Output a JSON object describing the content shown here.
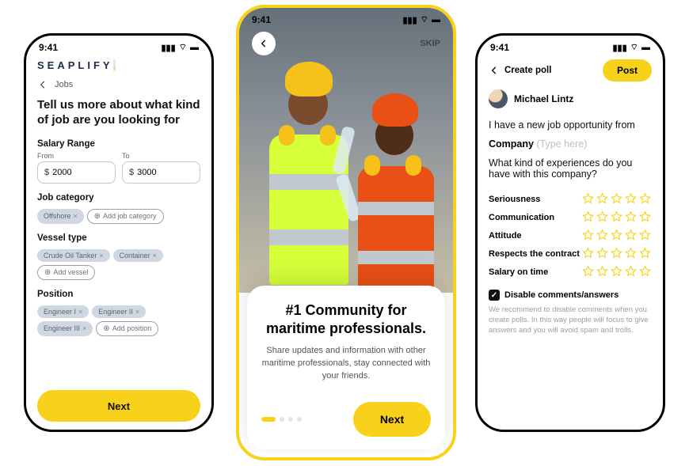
{
  "status": {
    "time": "9:41"
  },
  "left": {
    "brand": "SEAPLIFY",
    "back_label": "Jobs",
    "heading": "Tell us more about what kind of job are you looking for",
    "salary": {
      "section": "Salary Range",
      "from_label": "From",
      "to_label": "To",
      "from_value": "2000",
      "to_value": "3000",
      "currency": "$"
    },
    "category": {
      "section": "Job category",
      "chips": [
        "Offshore"
      ],
      "add": "Add job category"
    },
    "vessel": {
      "section": "Vessel type",
      "chips": [
        "Crude Oil Tanker",
        "Container"
      ],
      "add": "Add vessel"
    },
    "position": {
      "section": "Position",
      "chips": [
        "Engineer I",
        "Engineer II",
        "Engineer III"
      ],
      "add": "Add position"
    },
    "next": "Next"
  },
  "mid": {
    "skip": "SKIP",
    "title": "#1 Community for maritime professionals.",
    "subtitle": "Share updates and information with other maritime professionals, stay connected with your friends.",
    "next": "Next",
    "page_index": 0,
    "page_count": 4
  },
  "right": {
    "back_label": "Create poll",
    "post": "Post",
    "user_name": "Michael Lintz",
    "line1": "I have a new job opportunity from",
    "company_label": "Company",
    "company_placeholder": "(Type here)",
    "line2": "What kind of experiences do you have with this company?",
    "criteria": [
      "Seriousness",
      "Communication",
      "Attitude",
      "Respects the contract",
      "Salary on time"
    ],
    "disable_label": "Disable comments/answers",
    "disable_checked": true,
    "help": "We recommend to disable comments when you create polls. In this way people will focus to give answers and you will avoid spam and trolls."
  }
}
